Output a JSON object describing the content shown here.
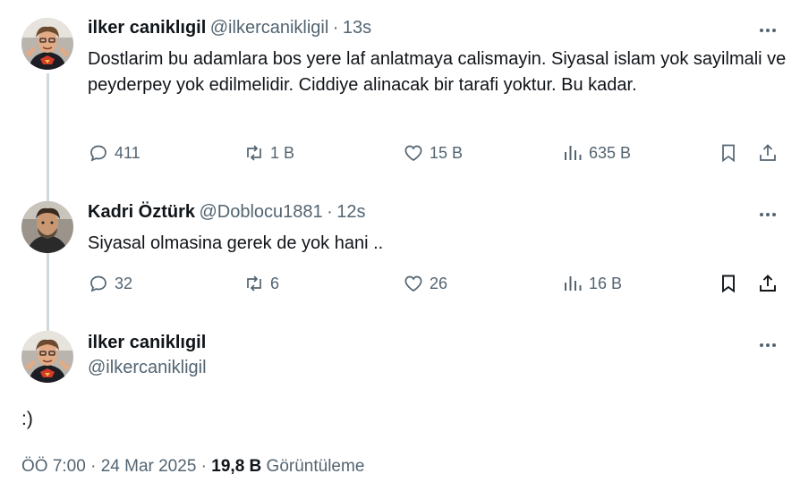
{
  "tweets": [
    {
      "name": "ilker caniklıgil",
      "handle": "@ilkercanikligil",
      "time": "13s",
      "text": "Dostlarim bu adamlara bos yere laf anlatmaya calismayin. Siyasal islam yok sayilmali ve peyderpey yok edilmelidir. Ciddiye alinacak bir tarafi yoktur. Bu kadar.",
      "replies": "411",
      "retweets": "1 B",
      "likes": "15 B",
      "views": "635 B"
    },
    {
      "name": "Kadri Öztürk",
      "handle": "@Doblocu1881",
      "time": "12s",
      "text": "Siyasal olmasina gerek de yok hani ..",
      "replies": "32",
      "retweets": "6",
      "likes": "26",
      "views": "16 B"
    }
  ],
  "main": {
    "name": "ilker caniklıgil",
    "handle": "@ilkercanikligil",
    "text": ":)",
    "timestamp": "ÖÖ 7:00 · 24 Mar 2025 ·",
    "views_count": "19,8 B",
    "views_label": "Görüntüleme"
  },
  "separator": "·",
  "colors": {
    "secondary": "#536471",
    "primary": "#0f1419",
    "thread_line": "#cfd9de"
  }
}
